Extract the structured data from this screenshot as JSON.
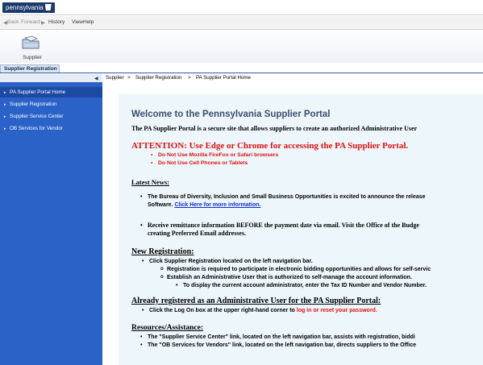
{
  "brand": {
    "name": "pennsylvania"
  },
  "menu": {
    "back": "Back",
    "forward": "Forward",
    "history": "History",
    "view": "View",
    "help": "Help"
  },
  "toolbar": {
    "supplier_label": "Supplier"
  },
  "tabs": {
    "active": "Supplier Registration"
  },
  "breadcrumb": [
    "Supplier",
    "Supplier Registration",
    "PA Supplier Portal Home"
  ],
  "breadcrumb_sep": ">",
  "sidebar": {
    "items": [
      {
        "label": "PA Supplier Portal Home",
        "active": true
      },
      {
        "label": "Supplier Registration",
        "active": false
      },
      {
        "label": "Supplier Service Center",
        "active": false
      },
      {
        "label": "OB Services for Vendor",
        "active": false
      }
    ]
  },
  "content": {
    "title": "Welcome to the Pennsylvania Supplier Portal",
    "intro": "The PA Supplier Portal is a secure site that allows suppliers to create an authorized Administrative User",
    "attention": "ATTENTION: Use Edge or Chrome for accessing the PA Supplier Portal.",
    "attention_bullets": [
      "Do Not Use Mozilla FireFox or Safari browsers",
      "Do Not Use Cell Phones or Tablets"
    ],
    "latest_news_heading": "Latest News:",
    "news1_line1": "The Bureau of Diversity, Inclusion and Small Business Opportunities is excited to announce the release",
    "news1_line2_prefix": "Software.",
    "news1_link": "Click Here for more information.",
    "news2_line1": "Receive remittance information BEFORE the payment date via email. Visit the Office of the Budge",
    "news2_line2": "creating Preferred Email addresses.",
    "new_reg_heading": "New Registration:",
    "new_reg_bullet": "Click Supplier Registration located on the left navigation bar.",
    "new_reg_sub1": "Registration is required to participate in electronic bidding opportunities and allows for self-servic",
    "new_reg_sub2": "Establish an Administrative User that is authorized to self-manage the account information.",
    "new_reg_subsub": "To display the current account administrator, enter the Tax ID Number and Vendor Number.",
    "already_heading": "Already registered as an Administrative User for the PA Supplier Portal:",
    "already_bullet_prefix": "Click the Log On box at the upper right-hand corner to",
    "already_bullet_red": "log in or reset your password.",
    "resources_heading": "Resources/Assistance:",
    "resources_b1": "The \"Supplier Service Center\" link, located on the left navigation bar, assists with registration, biddi",
    "resources_b2": "The \"OB Services for Vendors\" link, located on the left navigation bar, directs suppliers to the Office"
  },
  "colors": {
    "sidebar": "#2a62c8",
    "sidebar_active": "#1c4aa3",
    "title": "#3a4f6e",
    "alert": "#e01010",
    "link": "#1230c8",
    "content_bg": "#edf6fb"
  }
}
